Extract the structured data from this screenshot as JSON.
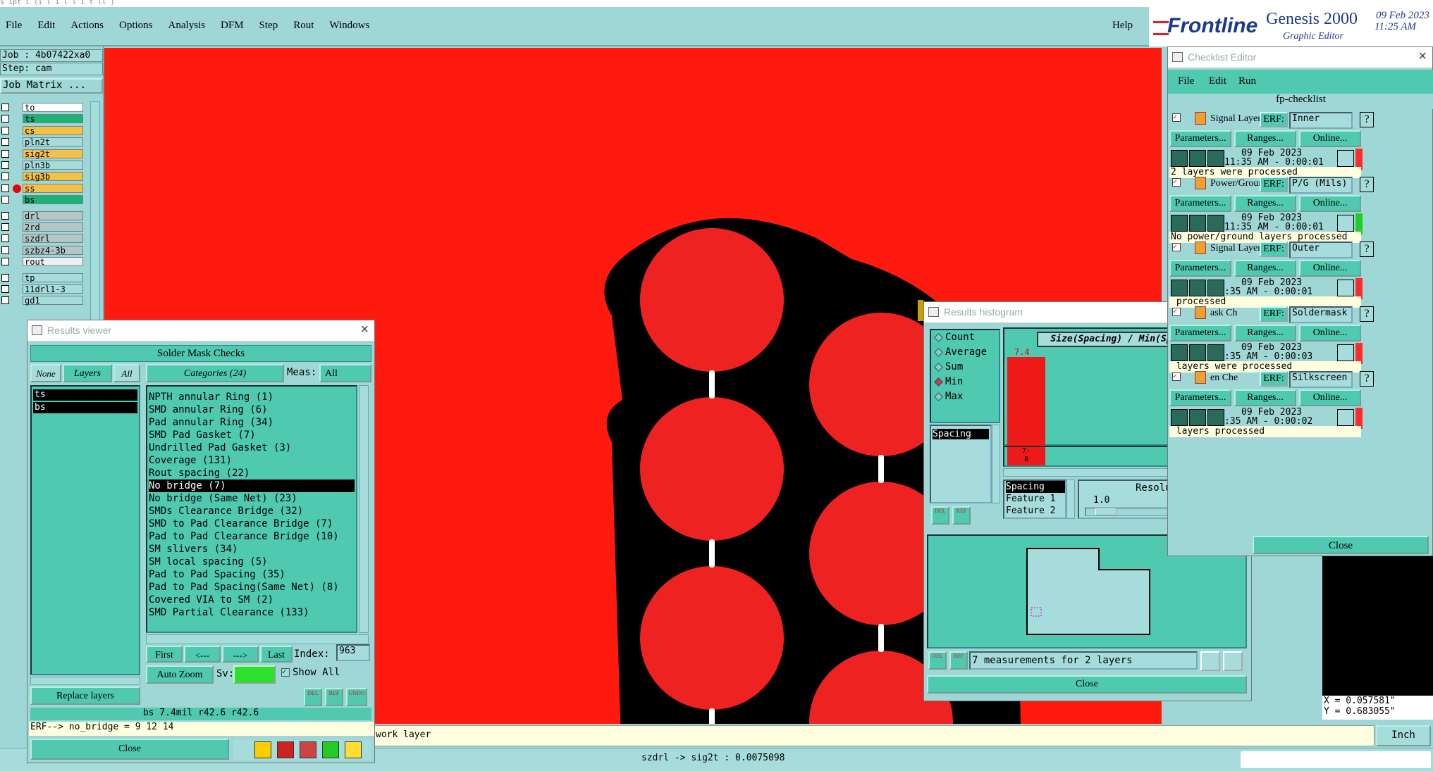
{
  "title_strip": "s  ipt i   (i   l   i    l         l      i  t    ll  )",
  "menubar": {
    "items": [
      "File",
      "Edit",
      "Actions",
      "Options",
      "Analysis",
      "DFM",
      "Step",
      "Rout",
      "Windows"
    ],
    "help": "Help"
  },
  "brand": {
    "logo": "Frontline",
    "product": "Genesis 2000",
    "subtitle": "Graphic Editor",
    "date": "09 Feb 2023",
    "time": "11:25 AM"
  },
  "job": {
    "job_label": "Job : 4b07422xa0",
    "step_label": "Step: cam",
    "matrix_button": "Job Matrix ..."
  },
  "layers": [
    "to",
    "ts",
    "cs",
    "pln2t",
    "sig2t",
    "pln3b",
    "sig3b",
    "ss",
    "bs",
    "drl",
    "2rd",
    "szdrl",
    "szbz4-3b",
    "rout",
    "tp",
    "11drl1-3",
    "gd1"
  ],
  "results_viewer": {
    "title": "Results viewer",
    "header": "Solder Mask Checks",
    "none_btn": "None",
    "layers_btn": "Layers",
    "all_btn": "All",
    "layer_list": [
      "ts",
      "bs"
    ],
    "categories_label": "Categories (24)",
    "meas_label": "Meas:",
    "meas_value": "All",
    "categories": [
      "NPTH annular Ring (1)",
      "SMD annular Ring (6)",
      "Pad annular Ring (34)",
      "SMD Pad Gasket (7)",
      "Undrilled Pad Gasket (3)",
      "Coverage (131)",
      "Rout spacing (22)",
      "No bridge (7)",
      "No bridge (Same Net) (23)",
      "SMDs Clearance Bridge (32)",
      "SMD to Pad Clearance Bridge (7)",
      "Pad to Pad Clearance Bridge (10)",
      "SM slivers (34)",
      "SM local spacing (5)",
      "Pad to Pad Spacing (35)",
      "Pad to Pad Spacing(Same Net) (8)",
      "Covered VIA to SM (2)",
      "SMD Partial Clearance (133)"
    ],
    "selected_category": "No bridge (7)",
    "first": "First",
    "prev": "<---",
    "next": "--->",
    "last": "Last",
    "index_label": "Index:",
    "index_value": "963",
    "autozoom": "Auto Zoom",
    "sv_label": "Sv:",
    "show_all": "Show All",
    "replace_layers": "Replace layers",
    "del": "DEL",
    "ref": "REF",
    "undo": "UNDO",
    "status": "bs 7.4mil  r42.6  r42.6",
    "erf": "ERF--> no_bridge = 9 12 14",
    "close": "Close"
  },
  "histogram": {
    "title": "Results histogram",
    "options": [
      "Count",
      "Average",
      "Sum",
      "Min",
      "Max"
    ],
    "selected": "Min",
    "chart_title": "Size(Spacing) / Min(Spacing)",
    "bar_value": "7.4",
    "bar_label": "7-\n8",
    "list_left": [
      "Spacing"
    ],
    "fields": [
      "Spacing",
      "Feature 1",
      "Feature 2"
    ],
    "resolution_label": "Resolution",
    "resolution_value": "1.0",
    "del": "DEL",
    "ref": "REF",
    "summary": "7 measurements for 2 layers",
    "close": "Close"
  },
  "checklist": {
    "title": "Checklist Editor",
    "menu": [
      "File",
      "Edit",
      "Run"
    ],
    "name": "fp-checklist",
    "erf_label": "ERF:",
    "params_btn": "Parameters...",
    "ranges_btn": "Ranges...",
    "online_btn": "Online...",
    "checks": [
      {
        "name": "Signal Layer Ch",
        "erf": "Inner",
        "date": "09 Feb 2023",
        "time": "11:35 AM - 0:00:01",
        "msg": "2 layers were processed",
        "status": "#ff2a2a"
      },
      {
        "name": "Power/Ground C",
        "erf": "P/G (Mils)",
        "date": "09 Feb 2023",
        "time": "11:35 AM - 0:00:01",
        "msg": "No power/ground layers processed",
        "status": "#1fd01f"
      },
      {
        "name": "Signal Layer Ch",
        "erf": "Outer",
        "date": "09 Feb 2023",
        "time": ":35 AM - 0:00:01",
        "msg": " processed",
        "status": "#ff2a2a"
      },
      {
        "name": "ask Ch",
        "erf": "Soldermask",
        "date": "09 Feb 2023",
        "time": ":35 AM - 0:00:03",
        "msg": " layers were processed",
        "status": "#ff2a2a"
      },
      {
        "name": "en Che",
        "erf": "Silkscreen",
        "date": "09 Feb 2023",
        "time": ":35 AM - 0:00:02",
        "msg": " layers processed",
        "status": "#ff2a2a"
      }
    ],
    "close": "Close"
  },
  "coords": {
    "x": "X = 0.057581\"",
    "y": "Y = 0.683055\""
  },
  "units": "Inch",
  "work_layer": "work layer",
  "statusbar": "szdrl -> sig2t : 0.0075098",
  "colors": {
    "board": "#ff1a10",
    "copper_hole": "#ef2222",
    "mask": "#000000",
    "teal": "#4fc9b0",
    "light": "#a6dcdc"
  }
}
